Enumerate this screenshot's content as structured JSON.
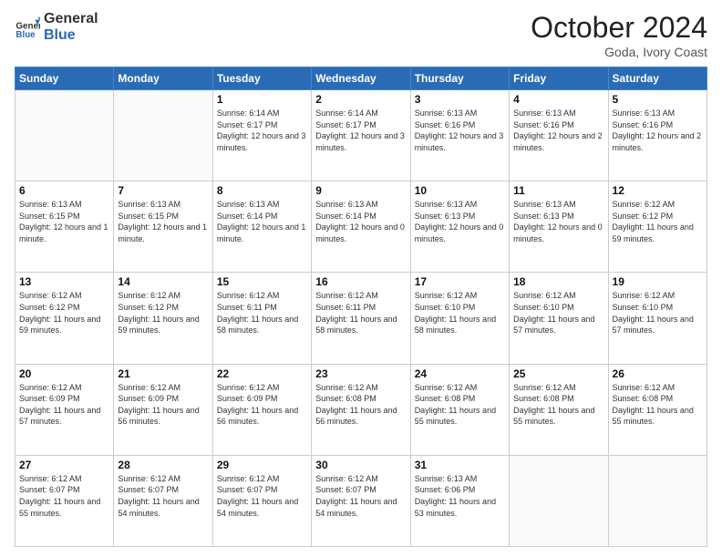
{
  "logo": {
    "general": "General",
    "blue": "Blue"
  },
  "header": {
    "month": "October 2024",
    "location": "Goda, Ivory Coast"
  },
  "days_of_week": [
    "Sunday",
    "Monday",
    "Tuesday",
    "Wednesday",
    "Thursday",
    "Friday",
    "Saturday"
  ],
  "weeks": [
    [
      {
        "day": "",
        "info": ""
      },
      {
        "day": "",
        "info": ""
      },
      {
        "day": "1",
        "info": "Sunrise: 6:14 AM\nSunset: 6:17 PM\nDaylight: 12 hours and 3 minutes."
      },
      {
        "day": "2",
        "info": "Sunrise: 6:14 AM\nSunset: 6:17 PM\nDaylight: 12 hours and 3 minutes."
      },
      {
        "day": "3",
        "info": "Sunrise: 6:13 AM\nSunset: 6:16 PM\nDaylight: 12 hours and 3 minutes."
      },
      {
        "day": "4",
        "info": "Sunrise: 6:13 AM\nSunset: 6:16 PM\nDaylight: 12 hours and 2 minutes."
      },
      {
        "day": "5",
        "info": "Sunrise: 6:13 AM\nSunset: 6:16 PM\nDaylight: 12 hours and 2 minutes."
      }
    ],
    [
      {
        "day": "6",
        "info": "Sunrise: 6:13 AM\nSunset: 6:15 PM\nDaylight: 12 hours and 1 minute."
      },
      {
        "day": "7",
        "info": "Sunrise: 6:13 AM\nSunset: 6:15 PM\nDaylight: 12 hours and 1 minute."
      },
      {
        "day": "8",
        "info": "Sunrise: 6:13 AM\nSunset: 6:14 PM\nDaylight: 12 hours and 1 minute."
      },
      {
        "day": "9",
        "info": "Sunrise: 6:13 AM\nSunset: 6:14 PM\nDaylight: 12 hours and 0 minutes."
      },
      {
        "day": "10",
        "info": "Sunrise: 6:13 AM\nSunset: 6:13 PM\nDaylight: 12 hours and 0 minutes."
      },
      {
        "day": "11",
        "info": "Sunrise: 6:13 AM\nSunset: 6:13 PM\nDaylight: 12 hours and 0 minutes."
      },
      {
        "day": "12",
        "info": "Sunrise: 6:12 AM\nSunset: 6:12 PM\nDaylight: 11 hours and 59 minutes."
      }
    ],
    [
      {
        "day": "13",
        "info": "Sunrise: 6:12 AM\nSunset: 6:12 PM\nDaylight: 11 hours and 59 minutes."
      },
      {
        "day": "14",
        "info": "Sunrise: 6:12 AM\nSunset: 6:12 PM\nDaylight: 11 hours and 59 minutes."
      },
      {
        "day": "15",
        "info": "Sunrise: 6:12 AM\nSunset: 6:11 PM\nDaylight: 11 hours and 58 minutes."
      },
      {
        "day": "16",
        "info": "Sunrise: 6:12 AM\nSunset: 6:11 PM\nDaylight: 11 hours and 58 minutes."
      },
      {
        "day": "17",
        "info": "Sunrise: 6:12 AM\nSunset: 6:10 PM\nDaylight: 11 hours and 58 minutes."
      },
      {
        "day": "18",
        "info": "Sunrise: 6:12 AM\nSunset: 6:10 PM\nDaylight: 11 hours and 57 minutes."
      },
      {
        "day": "19",
        "info": "Sunrise: 6:12 AM\nSunset: 6:10 PM\nDaylight: 11 hours and 57 minutes."
      }
    ],
    [
      {
        "day": "20",
        "info": "Sunrise: 6:12 AM\nSunset: 6:09 PM\nDaylight: 11 hours and 57 minutes."
      },
      {
        "day": "21",
        "info": "Sunrise: 6:12 AM\nSunset: 6:09 PM\nDaylight: 11 hours and 56 minutes."
      },
      {
        "day": "22",
        "info": "Sunrise: 6:12 AM\nSunset: 6:09 PM\nDaylight: 11 hours and 56 minutes."
      },
      {
        "day": "23",
        "info": "Sunrise: 6:12 AM\nSunset: 6:08 PM\nDaylight: 11 hours and 56 minutes."
      },
      {
        "day": "24",
        "info": "Sunrise: 6:12 AM\nSunset: 6:08 PM\nDaylight: 11 hours and 55 minutes."
      },
      {
        "day": "25",
        "info": "Sunrise: 6:12 AM\nSunset: 6:08 PM\nDaylight: 11 hours and 55 minutes."
      },
      {
        "day": "26",
        "info": "Sunrise: 6:12 AM\nSunset: 6:08 PM\nDaylight: 11 hours and 55 minutes."
      }
    ],
    [
      {
        "day": "27",
        "info": "Sunrise: 6:12 AM\nSunset: 6:07 PM\nDaylight: 11 hours and 55 minutes."
      },
      {
        "day": "28",
        "info": "Sunrise: 6:12 AM\nSunset: 6:07 PM\nDaylight: 11 hours and 54 minutes."
      },
      {
        "day": "29",
        "info": "Sunrise: 6:12 AM\nSunset: 6:07 PM\nDaylight: 11 hours and 54 minutes."
      },
      {
        "day": "30",
        "info": "Sunrise: 6:12 AM\nSunset: 6:07 PM\nDaylight: 11 hours and 54 minutes."
      },
      {
        "day": "31",
        "info": "Sunrise: 6:13 AM\nSunset: 6:06 PM\nDaylight: 11 hours and 53 minutes."
      },
      {
        "day": "",
        "info": ""
      },
      {
        "day": "",
        "info": ""
      }
    ]
  ]
}
